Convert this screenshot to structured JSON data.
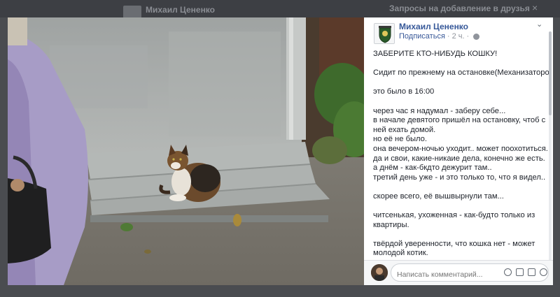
{
  "background": {
    "author_name": "Михаил Цененко",
    "friend_requests_title": "Запросы на добавление в друзья",
    "close_glyph": "×"
  },
  "photo": {
    "subject": "cat-on-bench-photo"
  },
  "post": {
    "author": "Михаил Цененко",
    "follow_label": "Подписаться",
    "dot": "·",
    "time": "2 ч.",
    "chevron": "⌄",
    "paragraphs": [
      [
        "ЗАБЕРИТЕ КТО-НИБУДЬ КОШКУ!"
      ],
      [
        "Сидит по прежнему на остановке(Механизаторов)"
      ],
      [
        "это было в 16:00"
      ],
      [
        "через час я надумал - заберу себе...",
        "в начале девятого пришёл на остановку, чтоб с",
        "ней ехать домой.",
        "но её не было.",
        "она вечером-ночью уходит.. может поохотиться.",
        "да и свои, какие-никаие дела, конечно же есть.",
        "а днём - как-бкдто дежурит там..",
        "третий день уже - и это только то, что я видел.."
      ],
      [
        "скорее всего, её вышвырнули там..."
      ],
      [
        "читсенькая, ухоженная - как-будто только из",
        "квартиры."
      ],
      [
        "твёрдой уверенности, что кошка нет - может",
        "молодой котик."
      ]
    ]
  },
  "comment": {
    "placeholder": "Написать комментарий..."
  },
  "icons": {
    "globe": "globe-icon",
    "emoji": "emoji-icon",
    "camera": "camera-icon",
    "gif": "gif-icon",
    "sticker": "sticker-icon"
  }
}
